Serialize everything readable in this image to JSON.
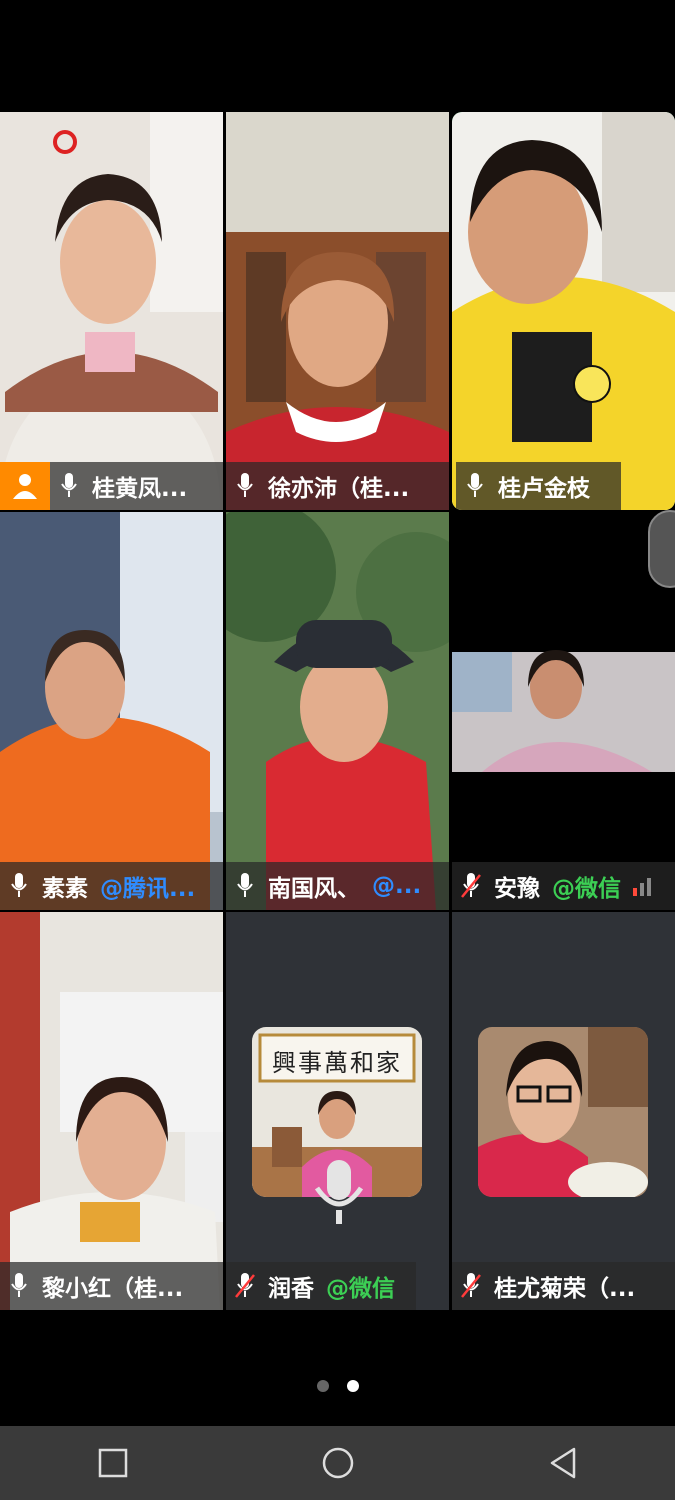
{
  "participants": [
    {
      "name": "桂黄凤...",
      "tag": "",
      "muted": false,
      "host": true
    },
    {
      "name": "徐亦沛（桂...",
      "tag": "",
      "muted": false,
      "host": false
    },
    {
      "name": "桂卢金枝",
      "tag": "",
      "muted": false,
      "host": false,
      "speaking": true
    },
    {
      "name": "素素",
      "tag": "@腾讯...",
      "tag_color": "blue",
      "muted": false,
      "host": false
    },
    {
      "name": "南国风、",
      "tag": "@...",
      "tag_color": "blue",
      "muted": false,
      "host": false
    },
    {
      "name": "安豫",
      "tag": "@微信",
      "tag_color": "green",
      "muted": true,
      "host": false
    },
    {
      "name": "黎小红（桂...",
      "tag": "",
      "muted": false,
      "host": false
    },
    {
      "name": "润香",
      "tag": "@微信",
      "tag_color": "green",
      "muted": true,
      "host": false,
      "video_off": true
    },
    {
      "name": "桂尤菊荣（...",
      "tag": "",
      "muted": true,
      "host": false,
      "video_off": true
    }
  ],
  "avatar_sign_text": "興事萬和家",
  "pagination": {
    "total": 2,
    "current": 2
  },
  "colors": {
    "speaking_border": "#21c25e",
    "host_badge": "#ff8a00",
    "tag_blue": "#2f8cff",
    "tag_green": "#3ccf54"
  },
  "nav": [
    "recents-square-icon",
    "home-circle-icon",
    "back-triangle-icon"
  ]
}
